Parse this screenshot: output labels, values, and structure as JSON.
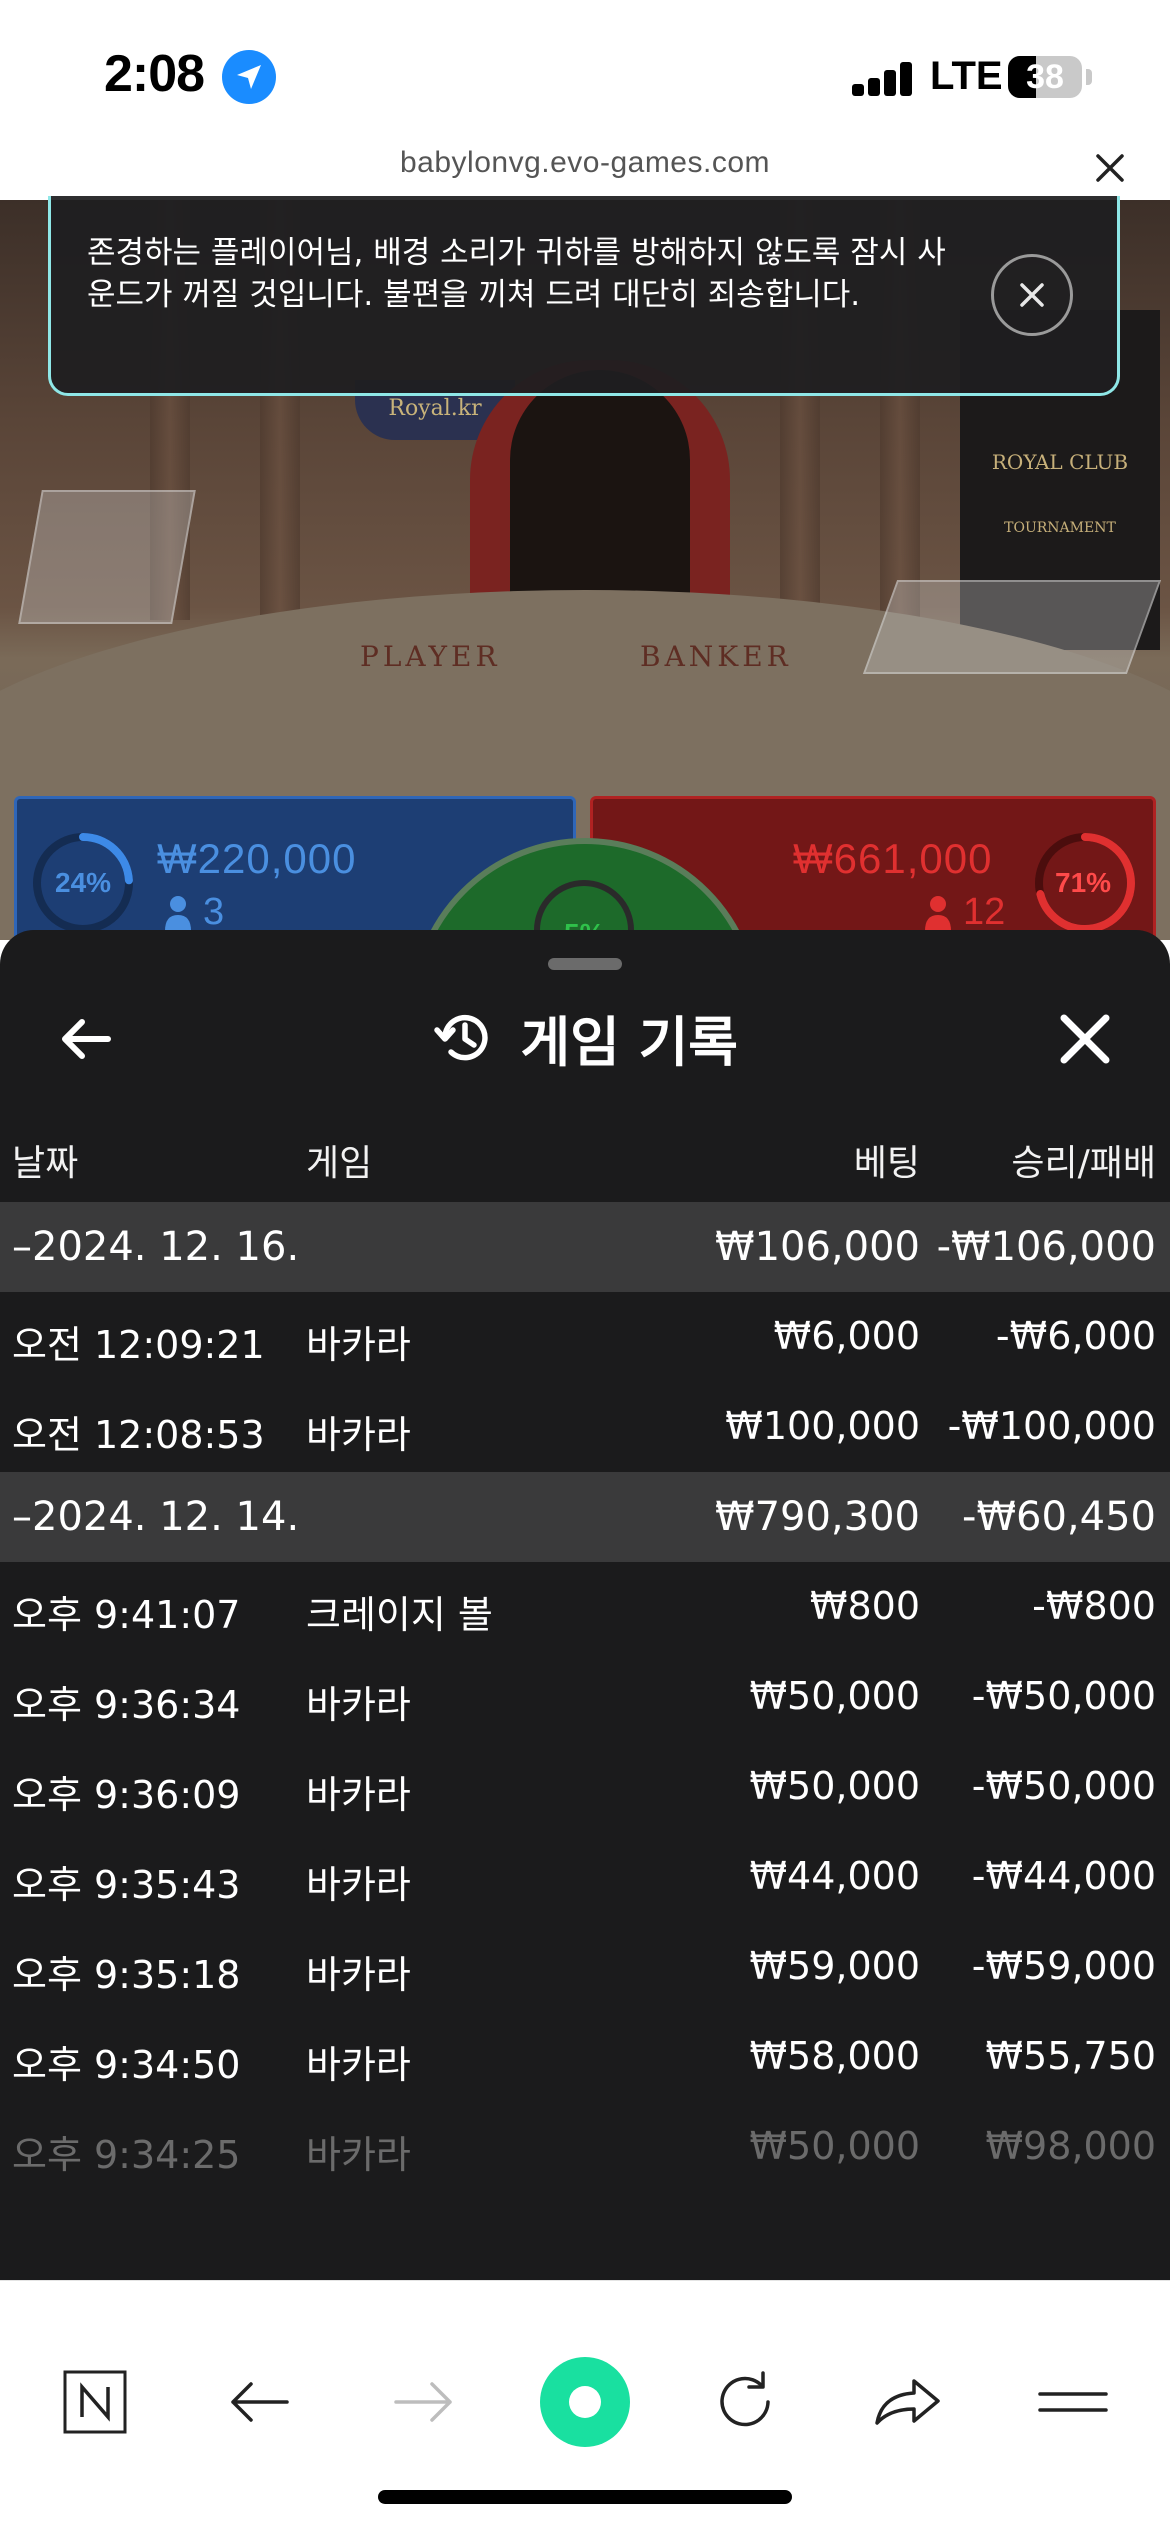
{
  "status_bar": {
    "time": "2:08",
    "network": "LTE",
    "battery": "38",
    "battery_level": 0.38
  },
  "browser": {
    "url": "babylonvg.evo-games.com"
  },
  "notice": {
    "text": "존경하는 플레이어님, 배경 소리가 귀하를 방해하지 않도록 잠시 사운드가 꺼질 것입니다. 불편을 끼쳐 드려 대단히 죄송합니다."
  },
  "video": {
    "table_player_label": "PLAYER",
    "table_banker_label": "BANKER",
    "sign_text": "Royal.kr",
    "club_text": "ROYAL CLUB",
    "club_subtext": "TOURNAMENT"
  },
  "bets": {
    "player": {
      "percent": "24%",
      "percent_value": 0.24,
      "amount": "₩220,000",
      "count": "3"
    },
    "tie": {
      "percent": "5%"
    },
    "banker": {
      "percent": "71%",
      "percent_value": 0.71,
      "amount": "₩661,000",
      "count": "12"
    }
  },
  "history": {
    "title": "게임 기록",
    "columns": {
      "date": "날짜",
      "game": "게임",
      "bet": "베팅",
      "result": "승리/패배"
    },
    "rows": [
      {
        "type": "group",
        "date": "–2024. 12. 16.",
        "game": "",
        "bet": "₩106,000",
        "result": "-₩106,000"
      },
      {
        "type": "item",
        "date": "오전 12:09:21",
        "game": "바카라",
        "bet": "₩6,000",
        "result": "-₩6,000"
      },
      {
        "type": "item",
        "date": "오전 12:08:53",
        "game": "바카라",
        "bet": "₩100,000",
        "result": "-₩100,000"
      },
      {
        "type": "group",
        "date": "–2024. 12. 14.",
        "game": "",
        "bet": "₩790,300",
        "result": "-₩60,450"
      },
      {
        "type": "item",
        "date": "오후 9:41:07",
        "game": "크레이지 볼",
        "bet": "₩800",
        "result": "-₩800"
      },
      {
        "type": "item",
        "date": "오후 9:36:34",
        "game": "바카라",
        "bet": "₩50,000",
        "result": "-₩50,000"
      },
      {
        "type": "item",
        "date": "오후 9:36:09",
        "game": "바카라",
        "bet": "₩50,000",
        "result": "-₩50,000"
      },
      {
        "type": "item",
        "date": "오후 9:35:43",
        "game": "바카라",
        "bet": "₩44,000",
        "result": "-₩44,000"
      },
      {
        "type": "item",
        "date": "오후 9:35:18",
        "game": "바카라",
        "bet": "₩59,000",
        "result": "-₩59,000"
      },
      {
        "type": "item",
        "date": "오후 9:34:50",
        "game": "바카라",
        "bet": "₩58,000",
        "result": "₩55,750"
      },
      {
        "type": "faded",
        "date": "오후 9:34:25",
        "game": "바카라",
        "bet": "₩50,000",
        "result": "₩98,000"
      }
    ]
  },
  "toolbar": {
    "items": [
      "naver-icon",
      "back-arrow-icon",
      "forward-arrow-icon",
      "green-dot-icon",
      "reload-icon",
      "share-icon",
      "menu-icon"
    ]
  },
  "colors": {
    "sheet_bg": "#1b1b1c",
    "group_row_bg": "#3a3a3b",
    "player_blue": "#2f66b8",
    "banker_red": "#b02222",
    "tie_green": "#2fc14a",
    "accent_mint": "#19e0a0",
    "notice_border": "#8fe7e7"
  }
}
